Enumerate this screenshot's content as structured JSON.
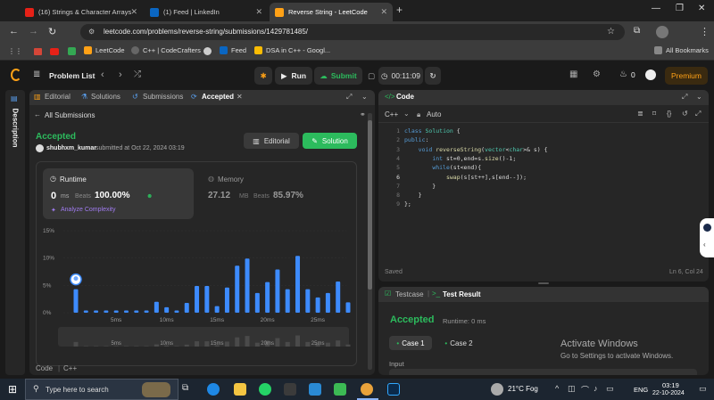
{
  "browser": {
    "tabs": [
      {
        "title": "(16) Strings & Character Arrays",
        "color": "#e62117"
      },
      {
        "title": "(1) Feed | LinkedIn",
        "color": "#0a66c2"
      },
      {
        "title": "Reverse String - LeetCode",
        "color": "#ffa116"
      }
    ],
    "url": "leetcode.com/problems/reverse-string/submissions/1429781485/",
    "bookmarks": [
      "LeetCode",
      "C++ | CodeCrafters",
      "Feed",
      "DSA in C++ - Googl...",
      "All Bookmarks"
    ]
  },
  "lc": {
    "problem_list": "Problem List",
    "run": "Run",
    "submit": "Submit",
    "timer": "00:11:09",
    "streak": "0",
    "premium": "Premium",
    "description": "Description"
  },
  "left": {
    "tabs": [
      "Editorial",
      "Solutions",
      "Submissions",
      "Accepted"
    ],
    "all_submissions": "All Submissions",
    "status": "Accepted",
    "user": "shubhxm_kumar",
    "submitted": "submitted at Oct 22, 2024 03:19",
    "editorial_btn": "Editorial",
    "solution_btn": "Solution",
    "runtime_label": "Runtime",
    "runtime_value": "0",
    "runtime_unit": "ms",
    "beats_label": "Beats",
    "runtime_beats": "100.00%",
    "analyze": "Analyze Complexity",
    "memory_label": "Memory",
    "memory_value": "27.12",
    "memory_unit": "MB",
    "memory_beats": "85.97%",
    "footer": [
      "Code",
      "C++"
    ]
  },
  "chart_data": {
    "type": "bar",
    "y_ticks": [
      "15%",
      "10%",
      "5%",
      "0%"
    ],
    "x_ticks": [
      "5ms",
      "10ms",
      "15ms",
      "20ms",
      "25ms"
    ],
    "ylim": [
      0,
      15
    ],
    "values": [
      4.3,
      0.4,
      0.4,
      0.4,
      0.4,
      0.4,
      0.4,
      0.4,
      2.0,
      1.0,
      0.4,
      1.8,
      4.9,
      4.9,
      1.2,
      4.6,
      8.6,
      9.9,
      3.6,
      5.6,
      7.9,
      4.3,
      10.4,
      4.3,
      2.8,
      3.6,
      5.7,
      1.9
    ],
    "highlight_index": 0
  },
  "code": {
    "title": "Code",
    "lang": "C++",
    "auto": "Auto",
    "saved": "Saved",
    "cursor": "Ln 6, Col 24",
    "lines": [
      "class Solution {",
      "public:",
      "    void reverseString(vector<char>& s) {",
      "        int st=0,end=s.size()-1;",
      "        while(st<end){",
      "            swap(s[st++],s[end--]);",
      "        }",
      "    }",
      "};"
    ]
  },
  "result": {
    "tabs": [
      "Testcase",
      "Test Result"
    ],
    "status": "Accepted",
    "runtime": "Runtime: 0 ms",
    "cases": [
      "Case 1",
      "Case 2"
    ],
    "input": "Input",
    "activate_title": "Activate Windows",
    "activate_sub": "Go to Settings to activate Windows."
  },
  "taskbar": {
    "search": "Type here to search",
    "weather": "21°C Fog",
    "lang": "ENG",
    "time": "03:19",
    "date": "22-10-2024"
  }
}
